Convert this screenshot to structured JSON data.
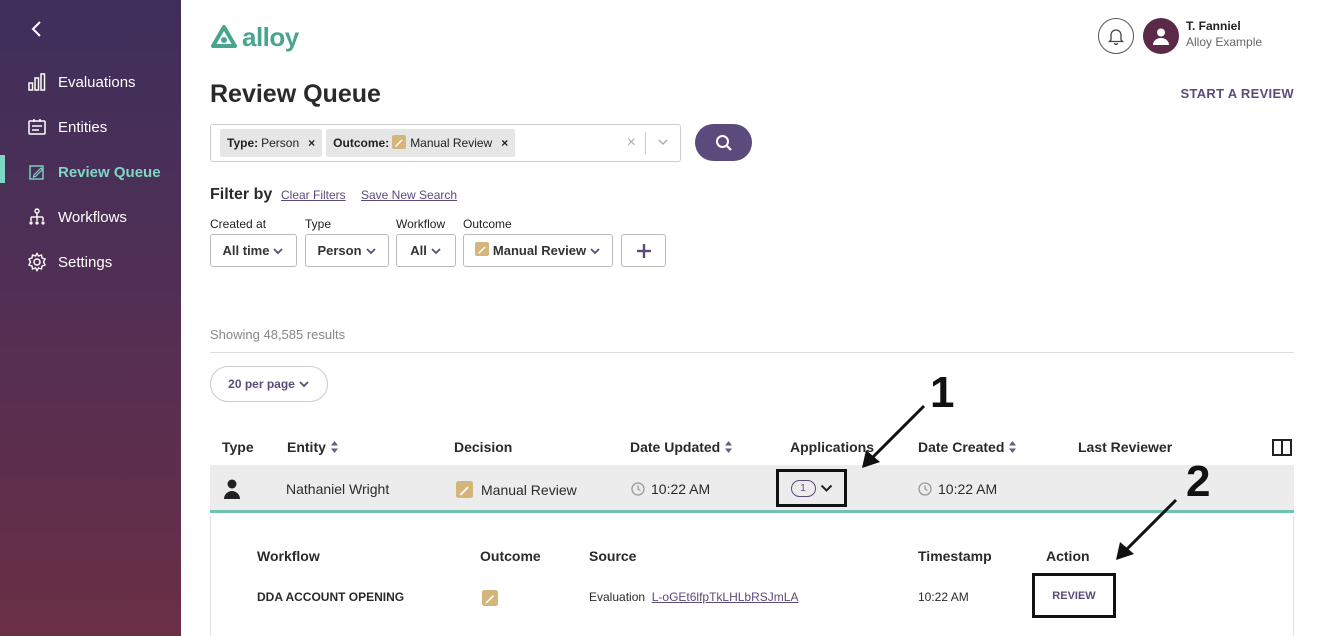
{
  "sidebar": {
    "items": [
      {
        "label": "Evaluations",
        "icon": "bar-chart-icon"
      },
      {
        "label": "Entities",
        "icon": "id-card-icon"
      },
      {
        "label": "Review Queue",
        "icon": "edit-square-icon",
        "active": true
      },
      {
        "label": "Workflows",
        "icon": "hierarchy-icon"
      },
      {
        "label": "Settings",
        "icon": "gear-icon"
      }
    ]
  },
  "brand": {
    "name": "alloy",
    "color": "#4aa58f",
    "accent": "#5b4b7c",
    "highlight": "#7fd6c4"
  },
  "user": {
    "name": "T. Fanniel",
    "org": "Alloy Example"
  },
  "page": {
    "title": "Review Queue",
    "start_review": "START A REVIEW"
  },
  "search": {
    "chips": [
      {
        "key": "Type:",
        "value": "Person"
      },
      {
        "key": "Outcome:",
        "value": "Manual Review"
      }
    ],
    "clear": "×"
  },
  "filters": {
    "heading": "Filter by",
    "clear_label": "Clear Filters",
    "save_label": "Save New Search",
    "created_at": {
      "label": "Created at",
      "value": "All time"
    },
    "type": {
      "label": "Type",
      "value": "Person"
    },
    "workflow": {
      "label": "Workflow",
      "value": "All"
    },
    "outcome": {
      "label": "Outcome",
      "value": "Manual Review"
    }
  },
  "results": {
    "count_text": "Showing 48,585 results",
    "per_page": "20 per page"
  },
  "table": {
    "headers": {
      "type": "Type",
      "entity": "Entity",
      "decision": "Decision",
      "date_updated": "Date Updated",
      "applications": "Applications",
      "date_created": "Date Created",
      "last_reviewer": "Last Reviewer"
    },
    "row": {
      "entity": "Nathaniel Wright",
      "decision": "Manual Review",
      "date_updated": "10:22 AM",
      "applications": "1",
      "date_created": "10:22 AM",
      "last_reviewer": ""
    }
  },
  "subtable": {
    "headers": {
      "workflow": "Workflow",
      "outcome": "Outcome",
      "source": "Source",
      "timestamp": "Timestamp",
      "action": "Action"
    },
    "row": {
      "workflow": "DDA ACCOUNT OPENING",
      "source_prefix": "Evaluation",
      "source_link": "L-oGEt6lfpTkLHLbRSJmLA",
      "timestamp": "10:22 AM",
      "action": "REVIEW"
    }
  },
  "annotations": {
    "one": "1",
    "two": "2"
  }
}
